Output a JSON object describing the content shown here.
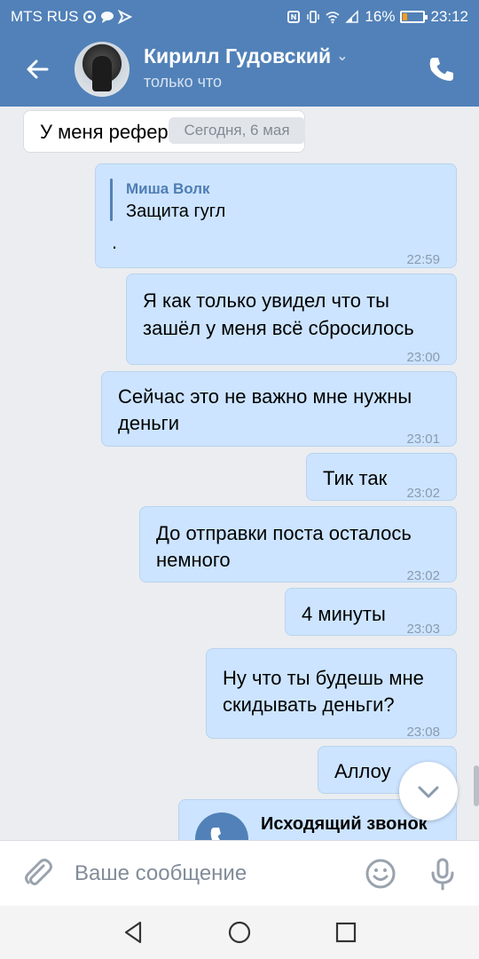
{
  "status_bar": {
    "carrier": "MTS RUS",
    "battery_percent": "16%",
    "time": "23:12",
    "icons": [
      "sync-icon",
      "chat-icon",
      "send-icon",
      "nfc-icon",
      "vibrate-icon",
      "wifi-icon",
      "signal-icon",
      "battery-icon"
    ]
  },
  "header": {
    "contact_name": "Кирилл Гудовский",
    "presence": "только что"
  },
  "chat": {
    "date_divider": "Сегодня, 6 мая",
    "first_incoming_partial": "У меня рефер",
    "reply_message": {
      "quoted_author": "Миша Волк",
      "quoted_text": "Защита гугл",
      "text": ".",
      "time": "22:59"
    },
    "messages": [
      {
        "line1": "Я как только увидел что ты",
        "line2": "зашёл у меня всё сбросилось",
        "time": "23:00"
      },
      {
        "line1": "Сейчас это не важно мне нужны",
        "line2": "деньги",
        "time": "23:01"
      },
      {
        "line1": "Тик так",
        "line2": "",
        "time": "23:02"
      },
      {
        "line1": "До отправки поста осталось",
        "line2": "немного",
        "time": "23:02"
      },
      {
        "line1": "4 минуты",
        "line2": "",
        "time": "23:03"
      },
      {
        "line1": "Ну что ты будешь мне",
        "line2": "скидывать деньги?",
        "time": "23:08"
      },
      {
        "line1": "Аллоу",
        "line2": "",
        "time": ""
      }
    ],
    "call_message": {
      "title": "Исходящий звонок"
    }
  },
  "composer": {
    "placeholder": "Ваше сообщение"
  },
  "colors": {
    "header_bg": "#5181b8",
    "outgoing_bubble": "#cce4ff",
    "incoming_bubble": "#ffffff",
    "chat_bg": "#ebedf0"
  }
}
